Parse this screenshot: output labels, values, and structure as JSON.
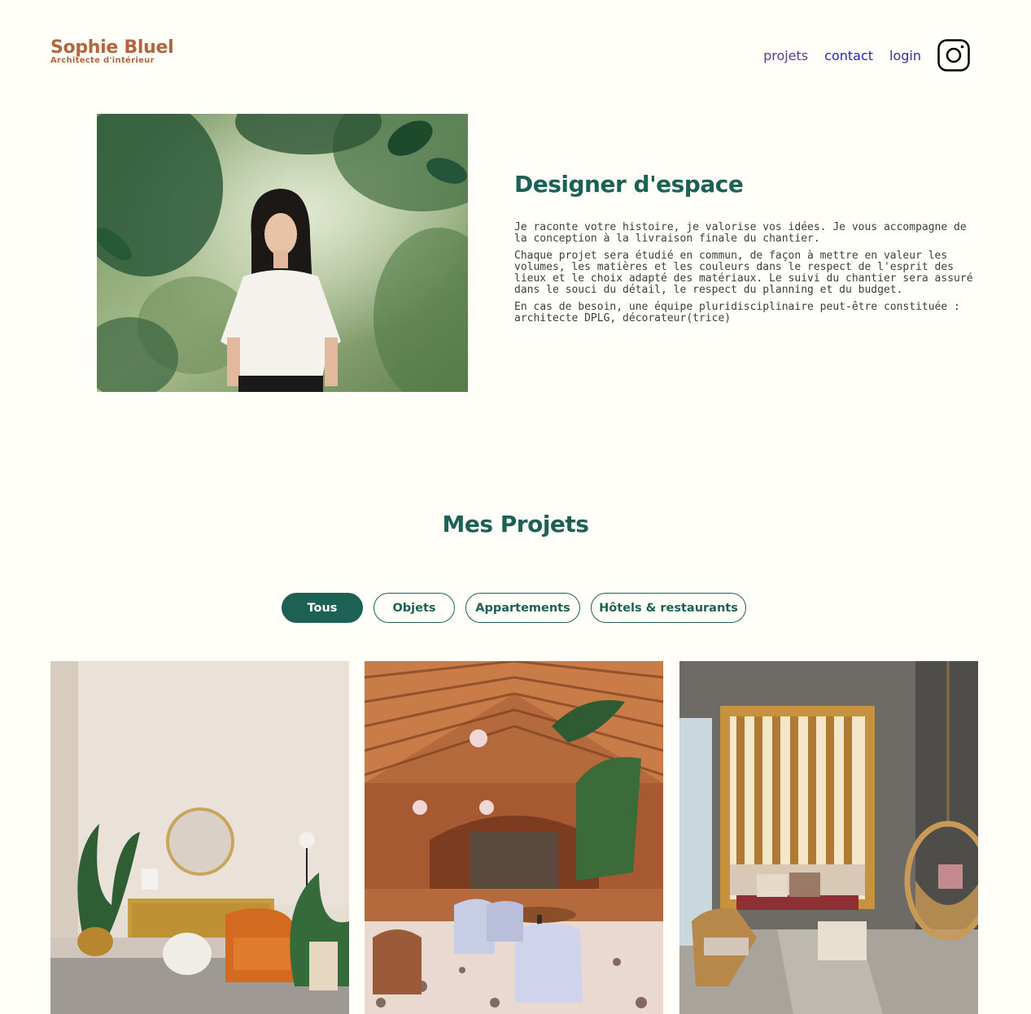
{
  "header": {
    "logo_title": "Sophie Bluel",
    "logo_subtitle": "Architecte d'intérieur",
    "nav": {
      "projets": "projets",
      "contact": "contact",
      "login": "login",
      "instagram_icon": "instagram-icon"
    }
  },
  "intro": {
    "title": "Designer d'espace",
    "paragraphs": [
      "Je raconte votre histoire, je valorise vos idées. Je vous accompagne de la conception à la livraison finale du chantier.",
      "Chaque projet sera étudié en commun, de façon à mettre en valeur les volumes, les matières et les couleurs dans le respect de l'esprit des lieux et le choix adapté des matériaux. Le suivi du chantier sera assuré dans le souci du détail, le respect du planning et du budget.",
      "En cas de besoin, une équipe pluridisciplinaire peut-être constituée : architecte DPLG, décorateur(trice)"
    ]
  },
  "projects": {
    "title": "Mes Projets",
    "filters": [
      "Tous",
      "Objets",
      "Appartements",
      "Hôtels & restaurants"
    ],
    "active_filter": "Tous"
  },
  "colors": {
    "background": "#FFFEF8",
    "brand_orange": "#B1663C",
    "brand_green": "#1D6154"
  }
}
